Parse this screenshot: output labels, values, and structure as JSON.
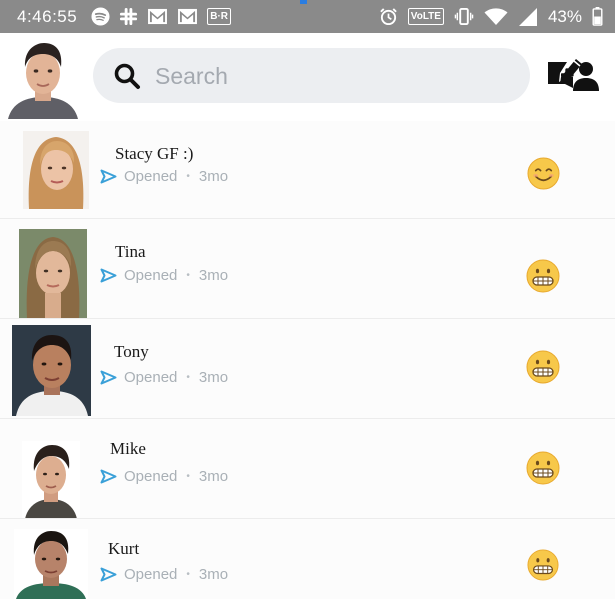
{
  "status_bar": {
    "time": "4:46:55",
    "icons_left": [
      "spotify-icon",
      "slack-icon",
      "gmail-icon",
      "gmail-icon",
      "br-app-icon"
    ],
    "br_label": "B·R",
    "icons_right": [
      "alarm-icon",
      "volte-icon",
      "vibrate-icon",
      "wifi-icon",
      "signal-icon",
      "battery-icon"
    ],
    "volte_label": "VoLTE",
    "battery_percent": "43%"
  },
  "header": {
    "search_placeholder": "Search",
    "icons": [
      "search-icon",
      "add-friend-icon",
      "new-chat-icon"
    ]
  },
  "chats": [
    {
      "name": "Stacy GF :)",
      "status": "Opened",
      "time": "3mo",
      "emoji": "smiling-face"
    },
    {
      "name": "Tina",
      "status": "Opened",
      "time": "3mo",
      "emoji": "grimacing-face"
    },
    {
      "name": "Tony",
      "status": "Opened",
      "time": "3mo",
      "emoji": "grimacing-face"
    },
    {
      "name": "Mike",
      "status": "Opened",
      "time": "3mo",
      "emoji": "grimacing-face"
    },
    {
      "name": "Kurt",
      "status": "Opened",
      "time": "3mo",
      "emoji": "grimacing-face"
    }
  ],
  "colors": {
    "status_bar": "#8a8a8a",
    "search_bg": "#eceef1",
    "sent_arrow": "#3aa0d8",
    "emoji_yellow": "#f7c84a",
    "meta_text": "#a9b0b6"
  }
}
